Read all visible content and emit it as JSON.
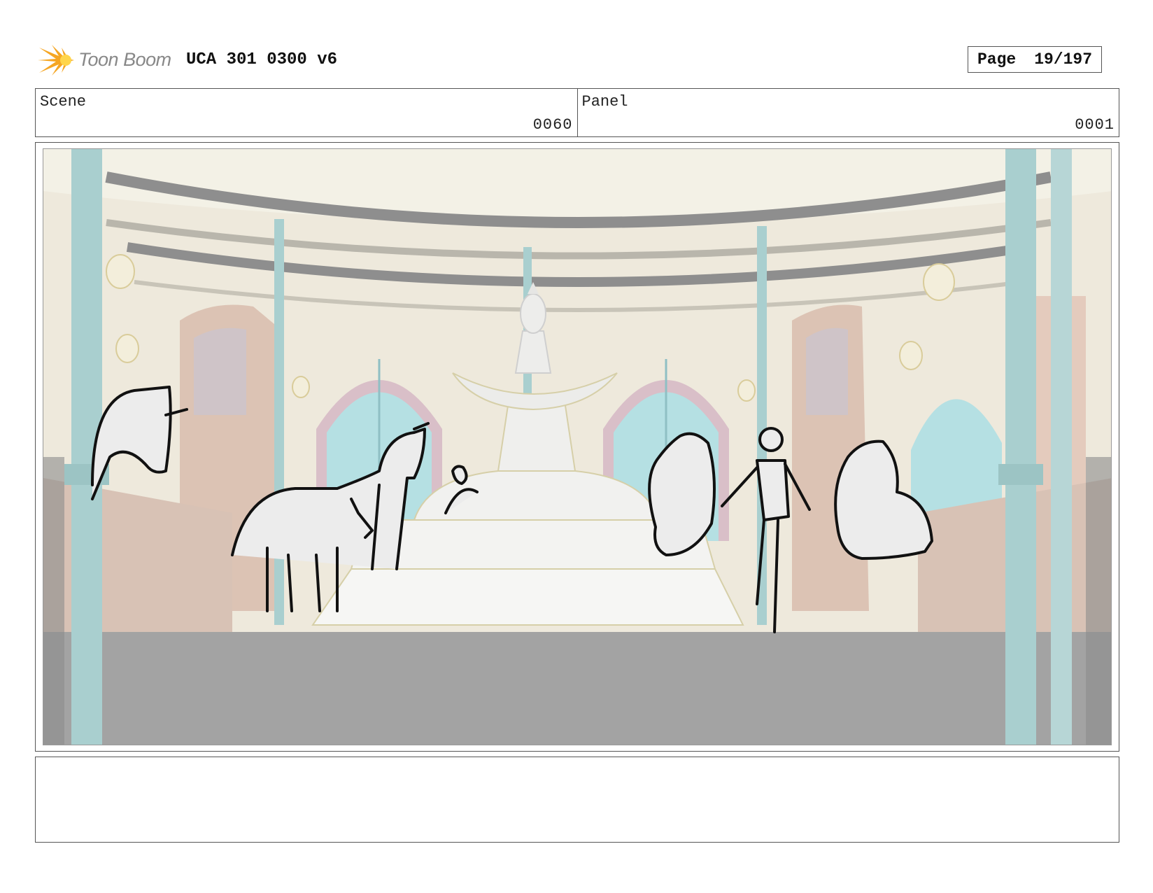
{
  "header": {
    "logo_text": "Toon Boom",
    "title": "UCA 301 0300 v6",
    "page_label": "Page",
    "page_value": "19/197"
  },
  "info": {
    "scene_label": "Scene",
    "scene_value": "0060",
    "panel_label": "Panel",
    "panel_value": "0001"
  },
  "panel": {
    "image": "storyboard-sketch-fountain-hall-unicorns"
  },
  "notes": {
    "text": ""
  },
  "colors": {
    "logo_orange": "#F5A623",
    "logo_yellow": "#FFD54A",
    "border": "#555555",
    "floor": "#A3A3A3",
    "wall": "#EEE9DC",
    "pillar": "#A9CFCF",
    "window": "#B5E0E3"
  }
}
